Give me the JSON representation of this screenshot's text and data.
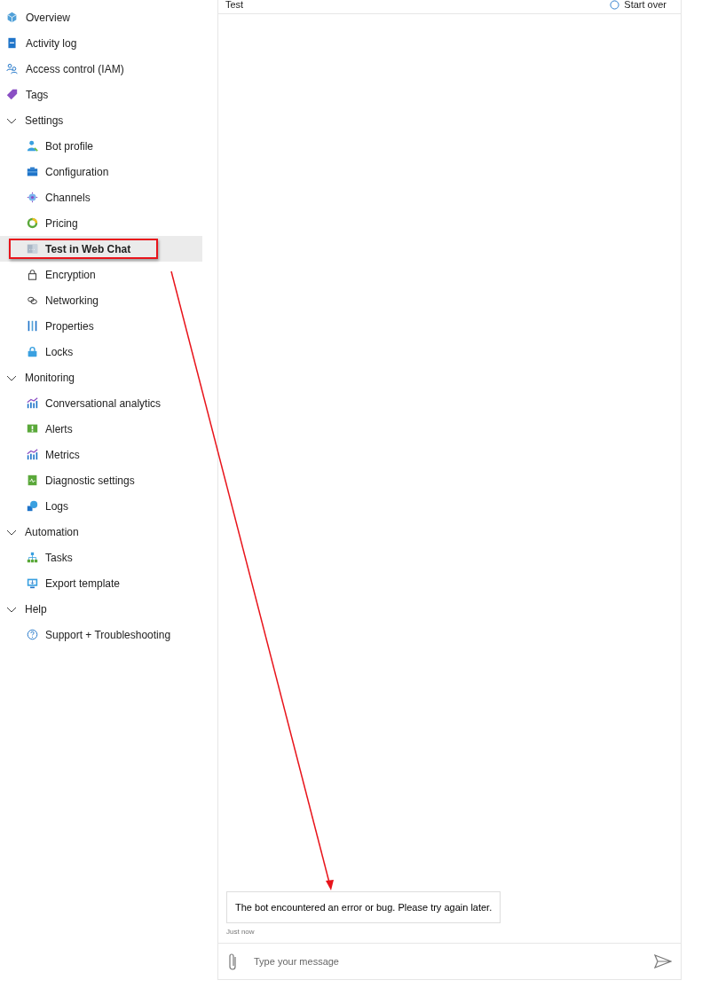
{
  "sidebar": {
    "items": [
      {
        "label": "Overview",
        "selected": false
      },
      {
        "label": "Activity log",
        "selected": false
      },
      {
        "label": "Access control (IAM)",
        "selected": false
      },
      {
        "label": "Tags",
        "selected": false
      },
      {
        "label": "Settings",
        "expanded": true,
        "children": [
          {
            "label": "Bot profile",
            "selected": false
          },
          {
            "label": "Configuration",
            "selected": false
          },
          {
            "label": "Channels",
            "selected": false
          },
          {
            "label": "Pricing",
            "selected": false
          },
          {
            "label": "Test in Web Chat",
            "selected": true,
            "highlighted": true
          },
          {
            "label": "Encryption",
            "selected": false
          },
          {
            "label": "Networking",
            "selected": false
          },
          {
            "label": "Properties",
            "selected": false
          },
          {
            "label": "Locks",
            "selected": false
          }
        ]
      },
      {
        "label": "Monitoring",
        "expanded": true,
        "children": [
          {
            "label": "Conversational analytics",
            "selected": false
          },
          {
            "label": "Alerts",
            "selected": false
          },
          {
            "label": "Metrics",
            "selected": false
          },
          {
            "label": "Diagnostic settings",
            "selected": false
          },
          {
            "label": "Logs",
            "selected": false
          }
        ]
      },
      {
        "label": "Automation",
        "expanded": true,
        "children": [
          {
            "label": "Tasks",
            "selected": false
          },
          {
            "label": "Export template",
            "selected": false
          }
        ]
      },
      {
        "label": "Help",
        "expanded": true,
        "children": [
          {
            "label": "Support + Troubleshooting",
            "selected": false
          }
        ]
      }
    ]
  },
  "chat": {
    "title": "Test",
    "start_over": "Start over",
    "messages": [
      {
        "text": "The bot encountered an error or bug. Please try again later.",
        "time": "Just now"
      }
    ],
    "input": {
      "placeholder": "Type your message"
    }
  },
  "annotations": [
    {
      "kind": "arrow"
    }
  ]
}
